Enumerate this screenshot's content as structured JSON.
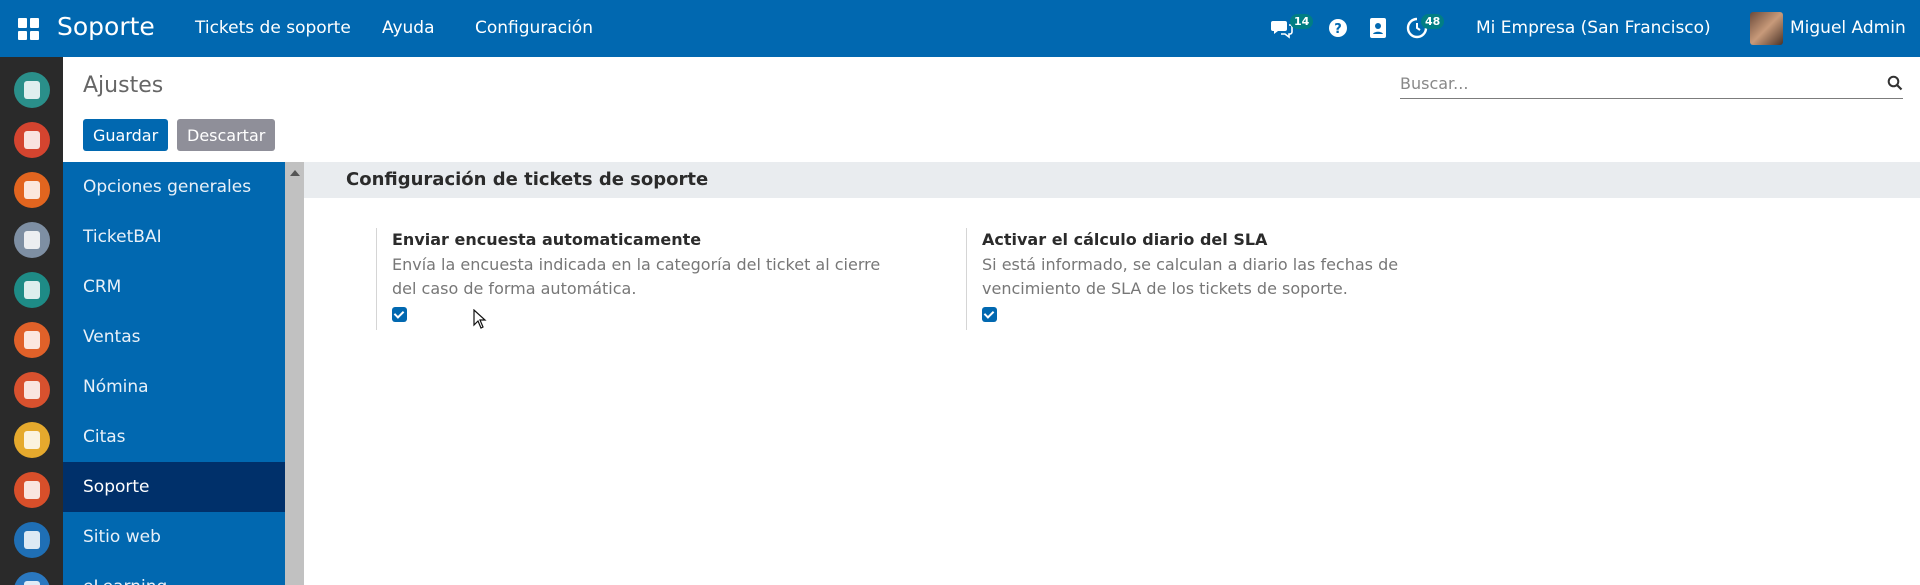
{
  "topbar": {
    "app_title": "Soporte",
    "menu": [
      "Tickets de soporte",
      "Ayuda",
      "Configuración"
    ],
    "messages_count": "14",
    "activities_count": "48",
    "company": "Mi Empresa (San Francisco)",
    "user": "Miguel Admin",
    "icons": [
      "apps-grid-icon",
      "chat-icon",
      "help-icon",
      "contacts-icon",
      "activity-clock-icon"
    ]
  },
  "control": {
    "title": "Ajustes",
    "search_placeholder": "Buscar...",
    "save_label": "Guardar",
    "discard_label": "Descartar"
  },
  "sidebar": {
    "items": [
      {
        "label": "Opciones generales",
        "active": false
      },
      {
        "label": "TicketBAI",
        "active": false
      },
      {
        "label": "CRM",
        "active": false
      },
      {
        "label": "Ventas",
        "active": false
      },
      {
        "label": "Nómina",
        "active": false
      },
      {
        "label": "Citas",
        "active": false
      },
      {
        "label": "Soporte",
        "active": true
      },
      {
        "label": "Sitio web",
        "active": false
      },
      {
        "label": "eLearning",
        "active": false
      }
    ]
  },
  "section": {
    "title": "Configuración de tickets de soporte",
    "settings": [
      {
        "title": "Enviar encuesta automaticamente",
        "desc": "Envía la encuesta indicada en la categoría del ticket al cierre del caso de forma automática.",
        "checked": true
      },
      {
        "title": "Activar el cálculo diario del SLA",
        "desc": "Si está informado, se calculan a diario las fechas de vencimiento de SLA de los tickets de soporte.",
        "checked": true
      }
    ]
  },
  "colors": {
    "brand": "#0168b0",
    "sidebar_active": "#00306a",
    "badge": "#017e84"
  }
}
